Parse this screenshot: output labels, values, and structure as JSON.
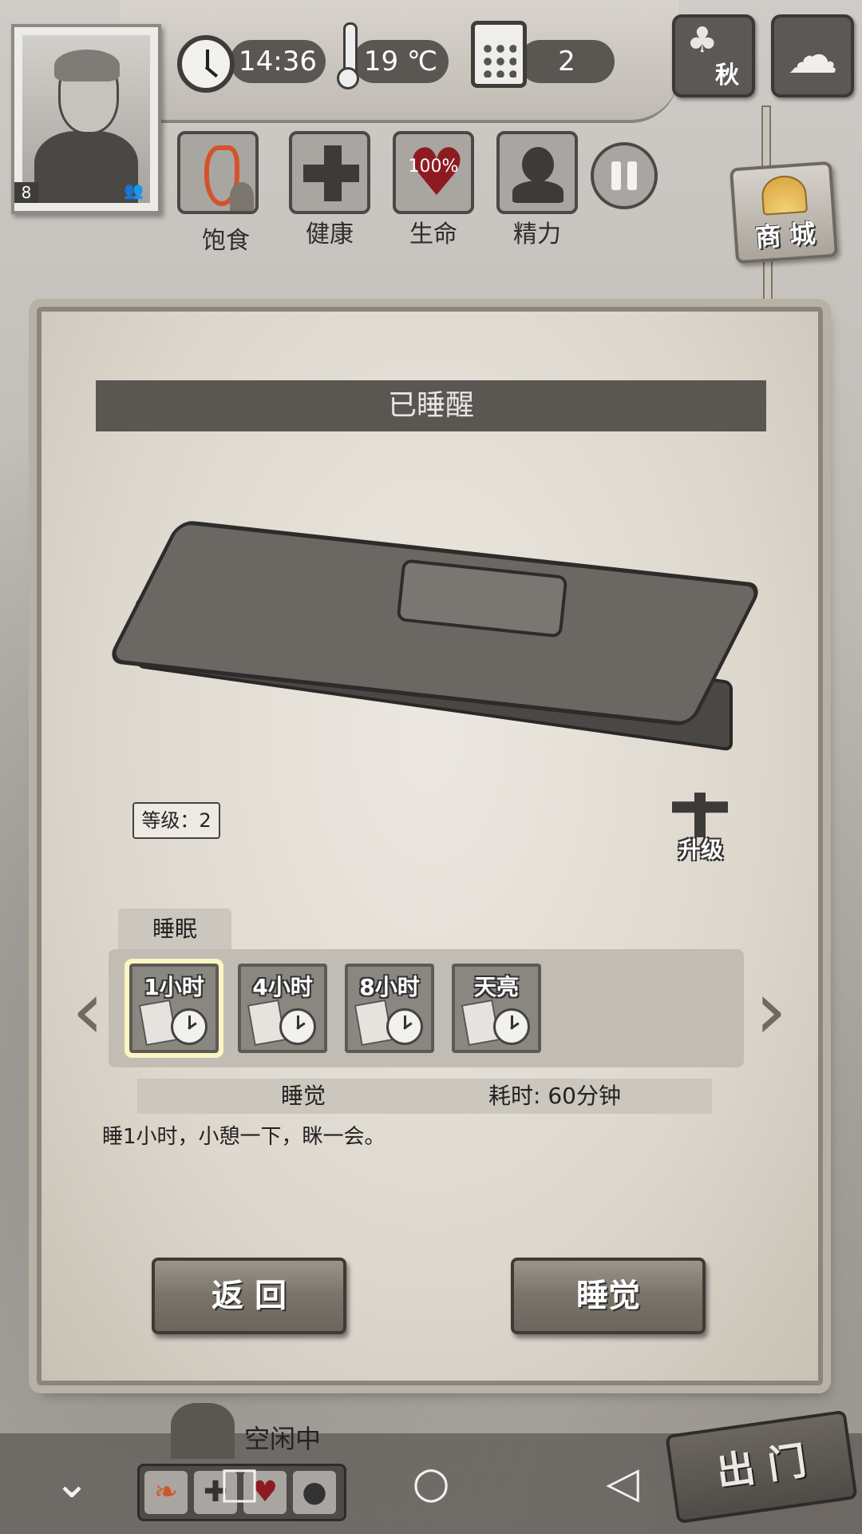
{
  "hud": {
    "time": "14:36",
    "temperature": "19 ℃",
    "day": "2",
    "season": "秋",
    "player_level": "8"
  },
  "status": {
    "hunger_label": "饱食",
    "health_label": "健康",
    "life_label": "生命",
    "life_value": "100%",
    "energy_label": "精力"
  },
  "shop": {
    "label": "商 城"
  },
  "panel": {
    "title": "已睡醒",
    "level_tag": "等级：2",
    "upgrade_label": "升级",
    "tab_label": "睡眠",
    "options": [
      {
        "label": "1小时",
        "selected": true
      },
      {
        "label": "4小时",
        "selected": false
      },
      {
        "label": "8小时",
        "selected": false
      },
      {
        "label": "天亮",
        "selected": false
      }
    ],
    "action_name": "睡觉",
    "duration": "耗时: 60分钟",
    "description": "睡1小时，小憩一下，眯一会。",
    "back_button": "返 回",
    "sleep_button": "睡觉"
  },
  "bottom": {
    "idle_status": "空闲中",
    "exit_label": "出 门"
  },
  "colors": {
    "panel_bg": "#ddd7cd",
    "title_bar": "#5a5753",
    "selected_outline": "#fbf5c4",
    "heart_red": "#8e1b22",
    "hunger_orange": "#d4532c"
  }
}
